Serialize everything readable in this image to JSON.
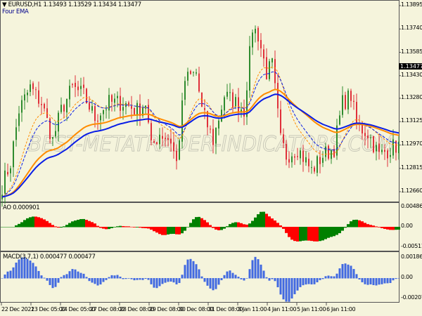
{
  "header": {
    "symbol_line": "▼ EURUSD,H1  1.13493 1.13529 1.13434 1.13477",
    "indicator_name": "Four EMA"
  },
  "watermark": "BEST-METATRADER-INDICATORS.COM",
  "current_price": "1.13477",
  "colors": {
    "background": "#f5f4dc",
    "bull": "#2e8b2e",
    "bear": "#e0303a",
    "ema_slow": "#0a1ee6",
    "ema_orange": "#ff8c00",
    "ao_up": "#008000",
    "ao_down": "#ff0000",
    "macd": "#4169e1"
  },
  "chart_data": [
    {
      "type": "candlestick",
      "title": "EURUSD,H1",
      "indicators": [
        "EMA slow (blue)",
        "EMA (orange)",
        "EMA fast dashed (blue)",
        "EMA fast dashed (orange)"
      ],
      "y_ticks": [
        "1.13895",
        "1.13740",
        "1.13585",
        "1.13430",
        "1.13280",
        "1.13125",
        "1.12970",
        "1.12815",
        "1.12660"
      ],
      "ylim": [
        1.126,
        1.1393
      ],
      "x_ticks": [
        "22 Dec 2021",
        "23 Dec 05:00",
        "24 Dec 05:00",
        "27 Dec 08:00",
        "28 Dec 08:00",
        "29 Dec 08:00",
        "30 Dec 08:00",
        "31 Dec 08:00",
        "3 Jan 11:00",
        "4 Jan 11:00",
        "5 Jan 11:00",
        "6 Jan 11:00"
      ],
      "close_path": {
        "bar": [
          0,
          3,
          6,
          10,
          14,
          18,
          21,
          25,
          29,
          33,
          38,
          43,
          48,
          51,
          53,
          56,
          60,
          62,
          65,
          69,
          71,
          75,
          79,
          83,
          86,
          89,
          91,
          94,
          96,
          99,
          101,
          105,
          110,
          114,
          118,
          121,
          124,
          126,
          130,
          134,
          138,
          141
        ],
        "price": [
          1.127,
          1.1285,
          1.132,
          1.1335,
          1.1325,
          1.13,
          1.132,
          1.1335,
          1.133,
          1.1315,
          1.1325,
          1.1325,
          1.132,
          1.1325,
          1.1295,
          1.1305,
          1.13,
          1.1285,
          1.134,
          1.1345,
          1.132,
          1.13,
          1.133,
          1.1325,
          1.132,
          1.1375,
          1.137,
          1.1345,
          1.135,
          1.13,
          1.129,
          1.1295,
          1.128,
          1.129,
          1.1295,
          1.1325,
          1.133,
          1.131,
          1.1305,
          1.129,
          1.1295,
          1.1297
        ]
      }
    },
    {
      "type": "bar",
      "title": "AO 0.000901",
      "y_ticks": [
        "0.004866",
        "0.00",
        "-0.005119"
      ],
      "ylim": [
        -0.005119,
        0.004866
      ]
    },
    {
      "type": "bar",
      "title": "MACD(3,7,1) 0.000477 0.000477",
      "y_ticks": [
        "0.00186",
        "0.00",
        "-0.002071"
      ],
      "ylim": [
        -0.002071,
        0.00186
      ]
    }
  ]
}
